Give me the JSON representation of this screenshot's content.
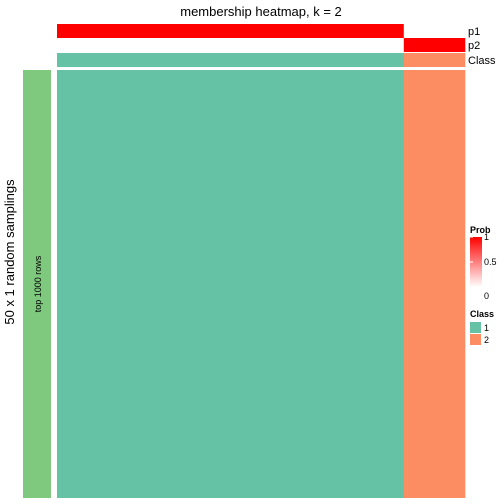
{
  "chart_data": {
    "type": "heatmap",
    "title": "membership heatmap, k = 2",
    "row_title": "50 x 1 random samplings",
    "row_group_label": "top 1000 rows",
    "annotation_rows": [
      "p1",
      "p2",
      "Class"
    ],
    "columns": [
      {
        "group": "1",
        "fraction": 0.85,
        "p1": 1,
        "p2": 0,
        "class": "1"
      },
      {
        "group": "2",
        "fraction": 0.15,
        "p1": 0,
        "p2": 1,
        "class": "2"
      }
    ],
    "legend_prob": {
      "title": "Prob",
      "ticks": [
        "1",
        "0.5",
        "0"
      ],
      "range": [
        0,
        1
      ]
    },
    "legend_class": {
      "title": "Class",
      "entries": [
        {
          "label": "1",
          "color": "#66C2A5"
        },
        {
          "label": "2",
          "color": "#FC8D62"
        }
      ]
    },
    "colors": {
      "prob_high": "#FF0000",
      "prob_low": "#FFFFFF",
      "row_band": "#7FC97F",
      "class1": "#66C2A5",
      "class2": "#FC8D62"
    }
  }
}
